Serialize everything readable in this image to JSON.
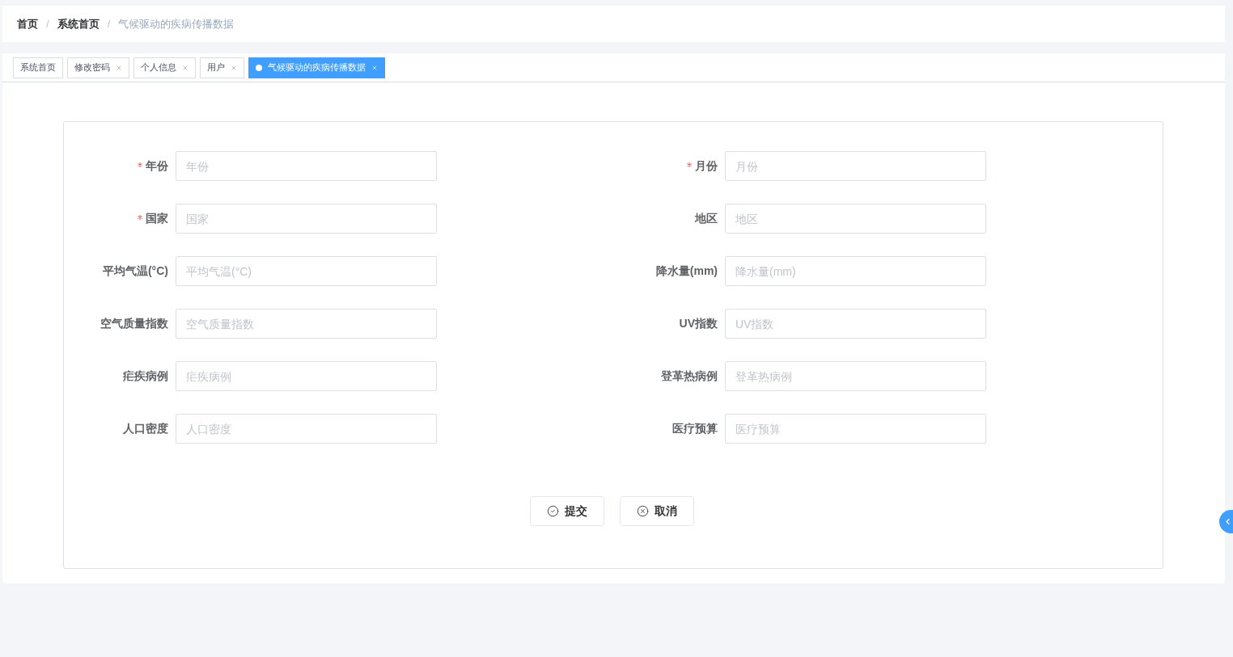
{
  "breadcrumb": [
    {
      "label": "首页",
      "current": false
    },
    {
      "separator": "/",
      "label": "系统首页",
      "current": false
    },
    {
      "separator": "/",
      "label": "气候驱动的疾病传播数据",
      "current": true
    }
  ],
  "tabs": [
    {
      "label": "系统首页",
      "selected": false,
      "closable": false
    },
    {
      "label": "修改密码",
      "selected": false,
      "closable": true
    },
    {
      "label": "个人信息",
      "selected": false,
      "closable": true
    },
    {
      "label": "用户",
      "selected": false,
      "closable": true
    },
    {
      "label": "气候驱动的疾病传播数据",
      "selected": true,
      "closable": true
    }
  ],
  "form": {
    "fields": [
      {
        "label": "年份",
        "placeholder": "年份",
        "required": true
      },
      {
        "label": "月份",
        "placeholder": "月份",
        "required": true
      },
      {
        "label": "国家",
        "placeholder": "国家",
        "required": true
      },
      {
        "label": "地区",
        "placeholder": "地区",
        "required": false
      },
      {
        "label": "平均气温(°C)",
        "placeholder": "平均气温(°C)",
        "required": false
      },
      {
        "label": "降水量(mm)",
        "placeholder": "降水量(mm)",
        "required": false
      },
      {
        "label": "空气质量指数",
        "placeholder": "空气质量指数",
        "required": false
      },
      {
        "label": "UV指数",
        "placeholder": "UV指数",
        "required": false
      },
      {
        "label": "疟疾病例",
        "placeholder": "疟疾病例",
        "required": false
      },
      {
        "label": "登革热病例",
        "placeholder": "登革热病例",
        "required": false
      },
      {
        "label": "人口密度",
        "placeholder": "人口密度",
        "required": false
      },
      {
        "label": "医疗预算",
        "placeholder": "医疗预算",
        "required": false
      }
    ],
    "buttons": [
      {
        "label": "提交",
        "kind": "submit"
      },
      {
        "label": "取消",
        "kind": "cancel"
      }
    ]
  }
}
